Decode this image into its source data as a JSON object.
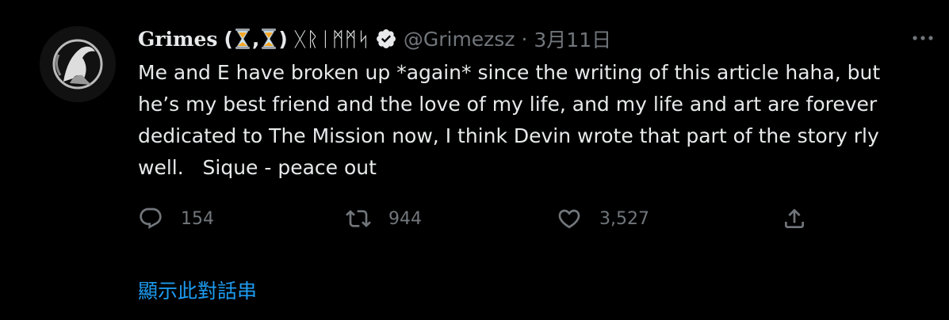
{
  "tweet": {
    "author": {
      "name": "Grimes",
      "paren_open": "(",
      "comma": ",",
      "paren_close": ")",
      "runes": "ᚷᚱᛁᛗᛗᛋ",
      "handle": "@Grimezsz",
      "separator": "·",
      "date": "3月11日"
    },
    "icons": {
      "hourglass": "hourglass-icon",
      "verified": "verified-badge-icon",
      "more": "more-icon"
    },
    "text": "Me and E have broken up *again* since the writing of this article haha, but\nhe’s my best friend and the love of my life, and my life and art are forever\ndedicated to The Mission now, I think Devin wrote that part of the story rly\nwell.   Sique - peace out",
    "actions": {
      "reply_count": "154",
      "retweet_count": "944",
      "like_count": "3,527"
    },
    "show_thread": "顯示此對話串"
  },
  "colors": {
    "background": "#000000",
    "text": "#e7e9ea",
    "secondary": "#71767b",
    "link": "#1d9bf0",
    "hourglass": "#f5a623"
  }
}
